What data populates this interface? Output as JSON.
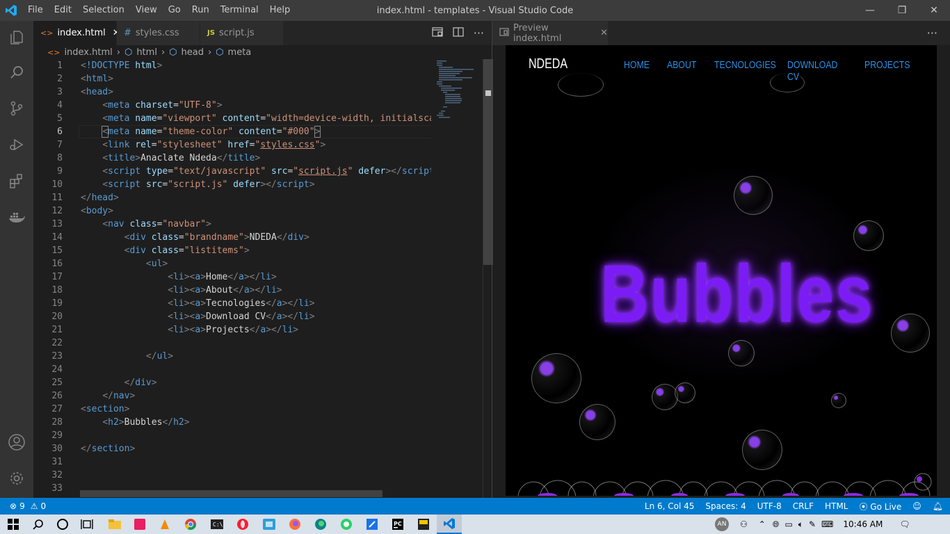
{
  "titlebar": {
    "menu": [
      "File",
      "Edit",
      "Selection",
      "View",
      "Go",
      "Run",
      "Terminal",
      "Help"
    ],
    "window_title": "index.html - templates - Visual Studio Code",
    "controls": [
      "—",
      "❐",
      "✕"
    ]
  },
  "activity_bar": {
    "icons": [
      "files-icon",
      "search-icon",
      "source-control-icon",
      "run-debug-icon",
      "extensions-icon",
      "docker-icon",
      "account-icon",
      "settings-gear-icon"
    ]
  },
  "tabs": [
    {
      "label": "index.html",
      "icon": "<>",
      "active": true
    },
    {
      "label": "styles.css",
      "icon": "#",
      "active": false
    },
    {
      "label": "script.js",
      "icon": "JS",
      "active": false
    }
  ],
  "tab_actions": [
    "open-preview-icon",
    "split-editor-icon",
    "more-actions-icon"
  ],
  "breadcrumb": [
    "index.html",
    "html",
    "head",
    "meta"
  ],
  "editor": {
    "lines": [
      "1",
      "2",
      "3",
      "4",
      "5",
      "6",
      "7",
      "8",
      "9",
      "10",
      "11",
      "12",
      "13",
      "14",
      "15",
      "16",
      "17",
      "18",
      "19",
      "20",
      "21",
      "22",
      "23",
      "24",
      "25",
      "26",
      "27",
      "28",
      "29",
      "30",
      "31",
      "32",
      "33"
    ],
    "code": {
      "doctype": "!DOCTYPE",
      "html_kw": "html",
      "charset": "UTF-8",
      "viewport_name": "viewport",
      "viewport_content": "width=device-width, initialscal",
      "theme_name": "theme-color",
      "theme_content": "#000",
      "stylesheet": "stylesheet",
      "styles_css": "styles.css",
      "title_text": "Anaclate Ndeda",
      "script_type": "text/javascript",
      "script_js": "script.js",
      "script_end": "script",
      "navbar": "navbar",
      "brandname": "brandname",
      "brand_text": "NDEDA",
      "listitems": "listitems",
      "li_home": "Home",
      "li_about": "About",
      "li_tech": "Tecnologies",
      "li_cv": "Download CV",
      "li_projects": "Projects",
      "h2_text": "Bubbles"
    }
  },
  "preview_tab": {
    "label": "Preview index.html"
  },
  "preview": {
    "brand": "NDEDA",
    "nav": [
      "HOME",
      "ABOUT",
      "TECNOLOGIES",
      "DOWNLOAD CV",
      "PROJECTS"
    ],
    "heading": "Bubbles"
  },
  "statusbar": {
    "problems": "9",
    "warnings": "0",
    "position": "Ln 6, Col 45",
    "spaces": "Spaces: 4",
    "encoding": "UTF-8",
    "eol": "CRLF",
    "language": "HTML",
    "golive": "Go Live"
  },
  "taskbar": {
    "apps": [
      "windows-start-icon",
      "search-icon",
      "cortana-icon",
      "task-view-icon",
      "file-explorer-icon",
      "app-icon",
      "vlc-icon",
      "chrome-icon",
      "terminal-icon",
      "opera-icon",
      "app-icon",
      "firefox-icon",
      "edge-icon",
      "whatsapp-icon",
      "app-icon",
      "pycharm-icon",
      "app-icon",
      "vscode-icon"
    ],
    "user": "AN",
    "time": "10:46 AM"
  },
  "colors": {
    "accent": "#007acc",
    "neon": "#7b1cf5",
    "navlink": "#2a8fe6"
  }
}
